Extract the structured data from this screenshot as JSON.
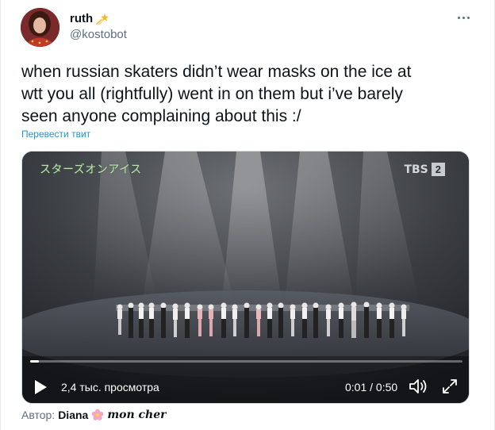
{
  "tweet": {
    "display_name": "ruth",
    "handle": "@kostobot",
    "text": "when russian skaters didn’t wear masks on the ice at\nwtt you all (rightfully) went in on them but i’ve barely\nseen anyone complaining about this :/",
    "translate_label": "Перевести твит"
  },
  "video": {
    "caption_jp": "スターズオンアイス",
    "broadcaster": "TBS",
    "channel_number": "2",
    "views": "2,4 тыс. просмотра",
    "time": "0:01 / 0:50",
    "progress": 0.02
  },
  "attribution": {
    "prefix": "Автор:",
    "author": "Diana",
    "suffix": "mon cher"
  },
  "icons": {
    "name_badge": "shooting-star-icon",
    "author_badge": "cherry-blossom-icon",
    "more": "more-icon",
    "play": "play-icon",
    "volume": "volume-icon",
    "fullscreen": "fullscreen-icon"
  },
  "colors": {
    "link": "#1b95e0",
    "secondary_text": "#5b7083",
    "primary_text": "#0f1419"
  }
}
